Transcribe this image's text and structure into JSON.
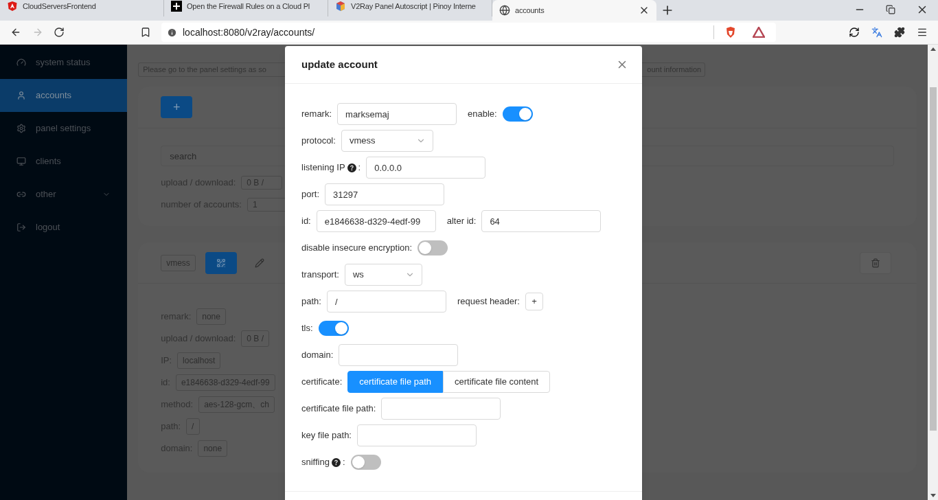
{
  "browser": {
    "tabs": [
      {
        "title": "CloudServersFrontend",
        "selected": false
      },
      {
        "title": "Open the Firewall Rules on a Cloud Pl",
        "selected": false
      },
      {
        "title": "V2Ray Panel Autoscript | Pinoy Interne",
        "selected": false
      },
      {
        "title": "accounts",
        "selected": true
      }
    ],
    "address": "localhost:8080/v2ray/accounts/"
  },
  "sidebar": {
    "items": [
      {
        "label": "system status",
        "selected": false,
        "expandable": false
      },
      {
        "label": "accounts",
        "selected": true,
        "expandable": false
      },
      {
        "label": "panel settings",
        "selected": false,
        "expandable": false
      },
      {
        "label": "clients",
        "selected": false,
        "expandable": false
      },
      {
        "label": "other",
        "selected": false,
        "expandable": true
      },
      {
        "label": "logout",
        "selected": false,
        "expandable": false
      }
    ]
  },
  "alert": {
    "start": "Please go to the panel settings as so",
    "end": "ount information"
  },
  "summary": {
    "add_button": "+",
    "search_placeholder": "search",
    "stats": [
      {
        "label": "upload / download:",
        "value": "0 B /"
      },
      {
        "label": "number of accounts:",
        "value": "1"
      }
    ]
  },
  "account": {
    "protocol": "vmess",
    "details": [
      {
        "label": "remark:",
        "value": "none"
      },
      {
        "label": "upload / download:",
        "value": "0 B /"
      },
      {
        "label": "IP:",
        "value": "localhost"
      },
      {
        "label": "id:",
        "value": "e1846638-d329-4edf-99"
      },
      {
        "label": "method:",
        "value": "aes-128-gcm、ch"
      },
      {
        "label": "path:",
        "value": "/"
      },
      {
        "label": "domain:",
        "value": "none"
      }
    ]
  },
  "modal": {
    "title": "update account",
    "rows": [
      {
        "items": [
          {
            "kind": "input",
            "label": "remark:",
            "value": "marksemaj"
          },
          {
            "kind": "switch",
            "label": "enable:",
            "on": true
          }
        ]
      },
      {
        "items": [
          {
            "kind": "select",
            "label": "protocol:",
            "value": "vmess"
          }
        ]
      },
      {
        "items": [
          {
            "kind": "input",
            "label": "listening IP",
            "help": true,
            "colon": ":",
            "value": "0.0.0.0"
          }
        ]
      },
      {
        "items": [
          {
            "kind": "input",
            "label": "port:",
            "value": "31297"
          }
        ]
      },
      {
        "items": [
          {
            "kind": "input",
            "label": "id:",
            "value": "e1846638-d329-4edf-99"
          },
          {
            "kind": "input",
            "label": "alter id:",
            "value": "64"
          }
        ]
      },
      {
        "items": [
          {
            "kind": "switch",
            "label": "disable insecure encryption:",
            "on": false
          }
        ]
      },
      {
        "items": [
          {
            "kind": "select",
            "label": "transport:",
            "value": "ws"
          }
        ]
      },
      {
        "items": [
          {
            "kind": "input",
            "label": "path:",
            "value": "/"
          },
          {
            "kind": "add",
            "label": "request header:",
            "button": "+"
          }
        ]
      },
      {
        "items": [
          {
            "kind": "switch",
            "label": "tls:",
            "on": true
          }
        ]
      },
      {
        "items": [
          {
            "kind": "input",
            "label": "domain:"
          }
        ]
      },
      {
        "items": [
          {
            "kind": "segmented",
            "label": "certificate:",
            "options": [
              {
                "label": "certificate file path",
                "selected": true
              },
              {
                "label": "certificate file content",
                "selected": false
              }
            ]
          }
        ]
      },
      {
        "items": [
          {
            "kind": "input",
            "label": "certificate file path:"
          }
        ]
      },
      {
        "items": [
          {
            "kind": "input",
            "label": "key file path:"
          }
        ]
      },
      {
        "items": [
          {
            "kind": "switch",
            "label": "sniffing",
            "help": true,
            "colon": ":",
            "on": false
          }
        ]
      }
    ]
  }
}
